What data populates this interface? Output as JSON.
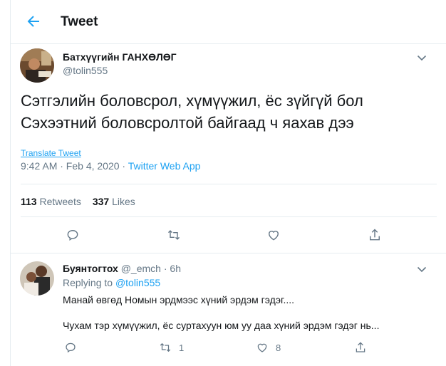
{
  "header": {
    "title": "Tweet"
  },
  "tweet": {
    "author_name": "Батхүүгийн ГАНХӨЛӨГ",
    "author_handle": "@tolin555",
    "text_lines": [
      "Сэтгэлийн боловсрол, хүмүүжил, ёс зүйгүй бол",
      "Сэхээтний боловсролтой байгаад ч яахав дээ"
    ],
    "translate_label": "Translate Tweet",
    "time": "9:42 AM · Feb 4, 2020 · ",
    "source": "Twitter Web App",
    "retweets_count": "113",
    "retweets_label": "Retweets",
    "likes_count": "337",
    "likes_label": "Likes"
  },
  "reply": {
    "author_name": "Буянтогтох",
    "author_handle": "@_emch",
    "time": "6h",
    "replying_prefix": "Replying to",
    "replying_handle": "@tolin555",
    "text_line1": "Манай өвгөд Номын эрдмээс хүний эрдэм гэдэг....",
    "text_line2": "Чухам тэр хүмүүжил, ёс суртахуун юм уу даа хүний эрдэм гэдэг нь...",
    "retweet_count": "1",
    "like_count": "8"
  },
  "icons": {
    "back": "back-arrow-icon",
    "caret": "chevron-down-icon",
    "reply": "reply-icon",
    "retweet": "retweet-icon",
    "like": "heart-icon",
    "share": "share-icon"
  },
  "colors": {
    "accent": "#1da1f2",
    "muted": "#657786",
    "text": "#14171a",
    "border": "#e6ecf0"
  }
}
